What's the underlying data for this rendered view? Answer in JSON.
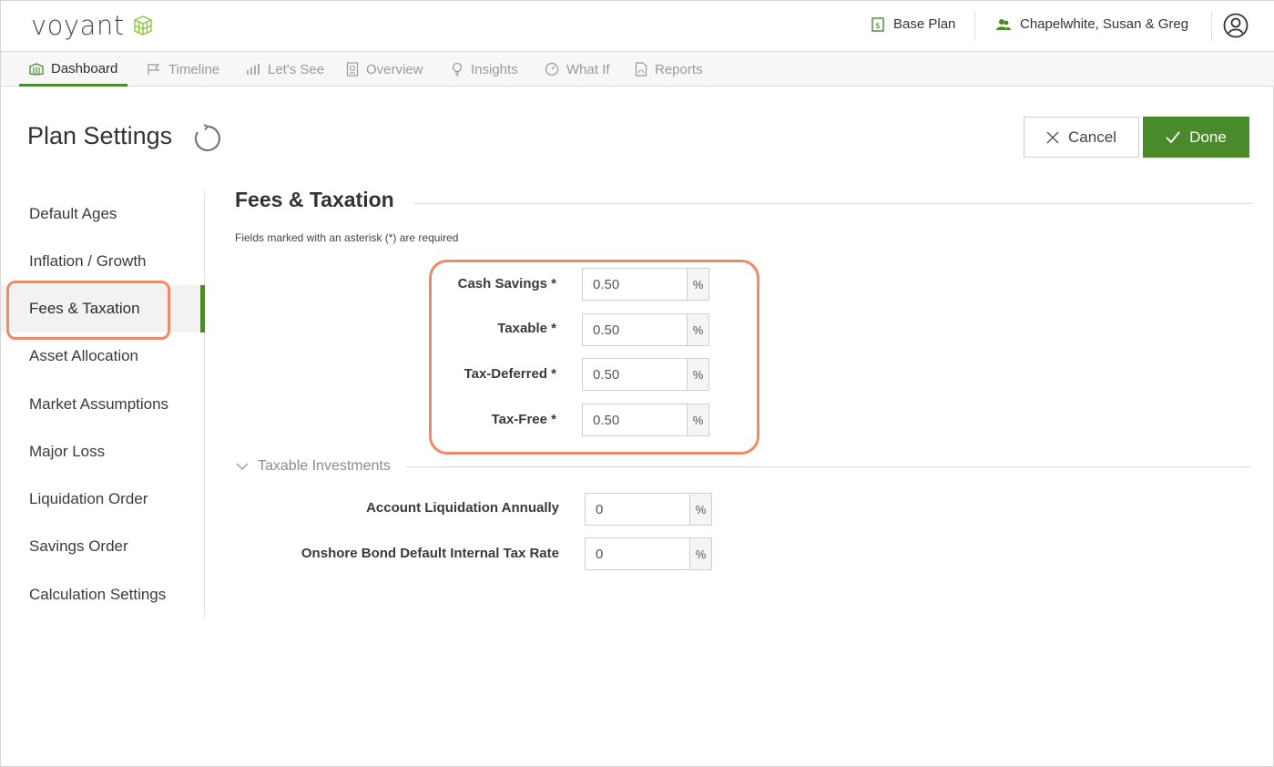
{
  "header": {
    "logo_text": "voyant",
    "plan_label": "Base Plan",
    "client_label": "Chapelwhite, Susan & Greg"
  },
  "nav": {
    "items": [
      {
        "label": "Dashboard",
        "icon": "dashboard-icon"
      },
      {
        "label": "Timeline",
        "icon": "flag-icon"
      },
      {
        "label": "Let's See",
        "icon": "bar-chart-icon"
      },
      {
        "label": "Overview",
        "icon": "document-icon"
      },
      {
        "label": "Insights",
        "icon": "lightbulb-icon"
      },
      {
        "label": "What If",
        "icon": "gauge-icon"
      },
      {
        "label": "Reports",
        "icon": "pdf-icon"
      }
    ],
    "active": "Dashboard"
  },
  "page": {
    "title": "Plan Settings",
    "cancel_label": "Cancel",
    "done_label": "Done"
  },
  "sidebar": {
    "items": [
      {
        "label": "Default Ages"
      },
      {
        "label": "Inflation / Growth"
      },
      {
        "label": "Fees & Taxation"
      },
      {
        "label": "Asset Allocation"
      },
      {
        "label": "Market Assumptions"
      },
      {
        "label": "Major Loss"
      },
      {
        "label": "Liquidation Order"
      },
      {
        "label": "Savings Order"
      },
      {
        "label": "Calculation Settings"
      }
    ],
    "active": "Fees & Taxation"
  },
  "content": {
    "section_title": "Fees & Taxation",
    "required_note": "Fields marked with an asterisk (*) are required",
    "fields": [
      {
        "label": "Cash Savings *",
        "value": "0.50",
        "unit": "%"
      },
      {
        "label": "Taxable *",
        "value": "0.50",
        "unit": "%"
      },
      {
        "label": "Tax-Deferred *",
        "value": "0.50",
        "unit": "%"
      },
      {
        "label": "Tax-Free *",
        "value": "0.50",
        "unit": "%"
      }
    ],
    "taxable_investments": {
      "title": "Taxable Investments",
      "fields": [
        {
          "label": "Account Liquidation Annually",
          "value": "0",
          "unit": "%"
        },
        {
          "label": "Onshore Bond Default Internal Tax Rate",
          "value": "0",
          "unit": "%"
        }
      ]
    }
  },
  "colors": {
    "accent_green": "#4a8a2a",
    "highlight_orange": "#f08a66"
  }
}
